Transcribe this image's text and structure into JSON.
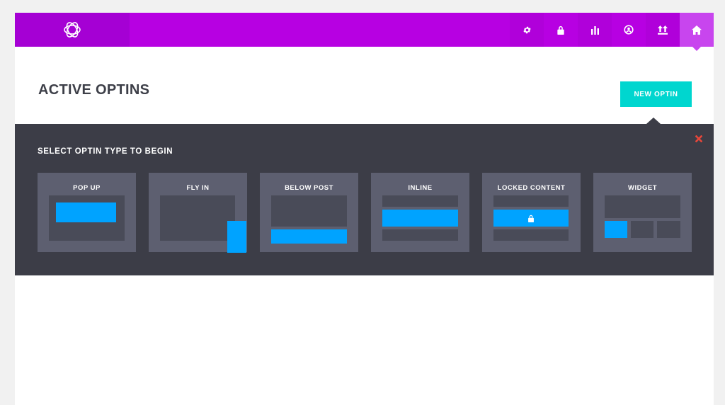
{
  "header": {
    "logo_icon": "bloom-logo-icon",
    "nav": [
      {
        "name": "settings",
        "icon": "gear-icon"
      },
      {
        "name": "lock",
        "icon": "lock-icon"
      },
      {
        "name": "stats",
        "icon": "bar-chart-icon"
      },
      {
        "name": "account",
        "icon": "user-circle-icon"
      },
      {
        "name": "import-export",
        "icon": "import-export-icon"
      },
      {
        "name": "home",
        "icon": "home-icon",
        "active": true
      }
    ]
  },
  "page": {
    "title": "ACTIVE OPTINS",
    "new_optin_label": "NEW OPTIN"
  },
  "panel": {
    "title": "SELECT OPTIN TYPE TO BEGIN",
    "close_icon": "close-icon",
    "cards": [
      {
        "label": "POP UP"
      },
      {
        "label": "FLY IN"
      },
      {
        "label": "BELOW POST"
      },
      {
        "label": "INLINE"
      },
      {
        "label": "LOCKED CONTENT"
      },
      {
        "label": "WIDGET"
      }
    ]
  },
  "colors": {
    "brand": "#b700e2",
    "accent": "#00d6cf",
    "panel": "#3c3d47",
    "card": "#5d5f70",
    "highlight": "#00a3ff",
    "close": "#e5463a"
  }
}
